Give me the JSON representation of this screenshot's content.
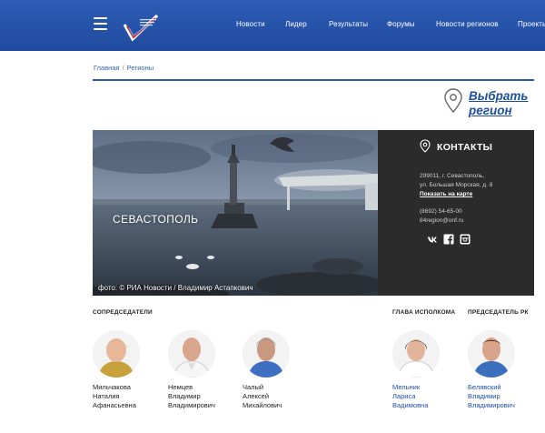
{
  "header": {
    "nav": [
      "Новости",
      "Лидер",
      "Результаты",
      "Форумы",
      "Новости регионов",
      "Проекты"
    ]
  },
  "breadcrumb": {
    "home": "Главная",
    "sep": "/",
    "current": "Регионы"
  },
  "region_select": {
    "line1": "Выбрать",
    "line2": "регион"
  },
  "banner": {
    "city": "СЕВАСТОПОЛЬ",
    "credit": "фото: © РИА Новости / Владимир Астапкович"
  },
  "contacts": {
    "title": "КОНТАКТЫ",
    "address_line1": "299011, г. Севастополь,",
    "address_line2": "ул. Большая Морская, д. 8",
    "map_link": "Показать на карте",
    "phone": "(8692) 54-65-00",
    "email": "84region@onf.ru",
    "social_icons": [
      "vk-icon",
      "facebook-icon",
      "instagram-icon"
    ]
  },
  "sections": {
    "cochairs": "СОПРЕДСЕДАТЕЛИ",
    "exec_head": "ГЛАВА ИСПОЛКОМА",
    "chair_rk": "ПРЕДСЕДАТЕЛЬ РК"
  },
  "people": [
    {
      "last": "Мильчакова",
      "first": "Наталия",
      "middle": "Афанасьевна"
    },
    {
      "last": "Немцев",
      "first": "Владимир",
      "middle": "Владимирович"
    },
    {
      "last": "Чалый",
      "first": "Алексей",
      "middle": "Михайлович"
    },
    {
      "last": "Мельник",
      "first": "Лариса",
      "middle": "Вадимовна"
    },
    {
      "last": "Белявский",
      "first": "Владимир",
      "middle": "Владимирович"
    }
  ],
  "colors": {
    "header": "#2e5db5",
    "accent": "#1f4fa3",
    "panel": "#2b2b2b"
  }
}
